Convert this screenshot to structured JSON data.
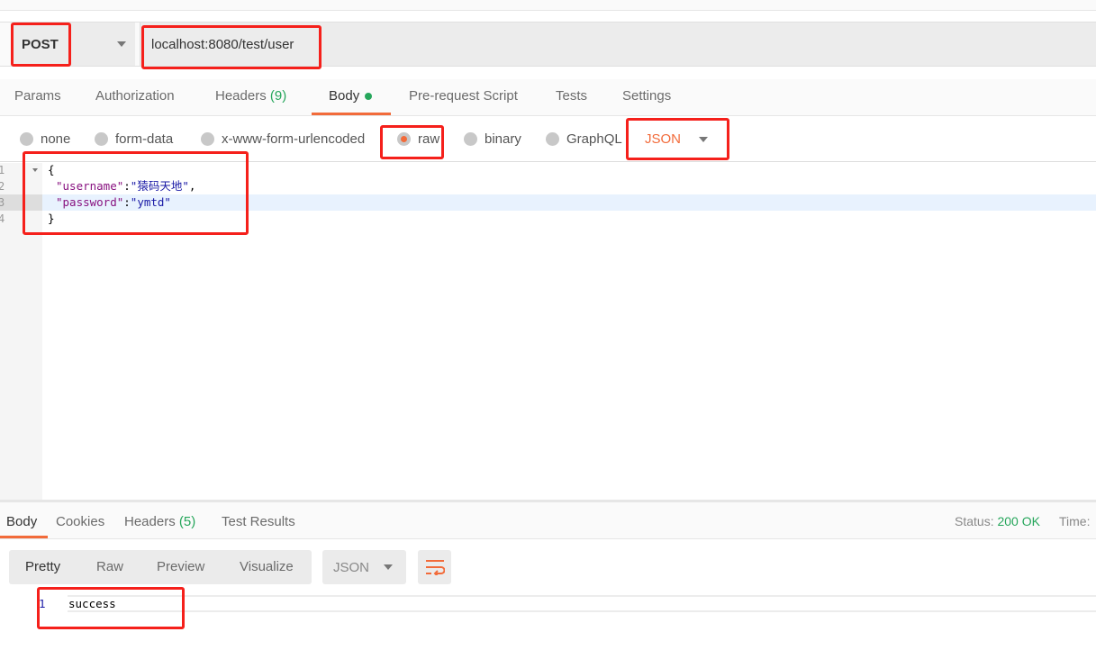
{
  "request": {
    "method": "POST",
    "url": "localhost:8080/test/user"
  },
  "request_tabs": [
    {
      "label": "Params"
    },
    {
      "label": "Authorization"
    },
    {
      "label": "Headers",
      "count": "(9)"
    },
    {
      "label": "Body",
      "active": true
    },
    {
      "label": "Pre-request Script"
    },
    {
      "label": "Tests"
    },
    {
      "label": "Settings"
    }
  ],
  "body_types": [
    {
      "label": "none"
    },
    {
      "label": "form-data"
    },
    {
      "label": "x-www-form-urlencoded"
    },
    {
      "label": "raw",
      "selected": true
    },
    {
      "label": "binary"
    },
    {
      "label": "GraphQL"
    }
  ],
  "body_format": "JSON",
  "editor": {
    "line_numbers": [
      "1",
      "2",
      "3",
      "4"
    ],
    "lines": [
      {
        "open": "{"
      },
      {
        "key": "\"username\"",
        "sep": ":",
        "value": "\"猿码天地\"",
        "end": ","
      },
      {
        "key": "\"password\"",
        "sep": ":",
        "value": "\"ymtd\"",
        "end": ""
      },
      {
        "close": "}"
      }
    ]
  },
  "response_tabs": [
    {
      "label": "Body",
      "active": true
    },
    {
      "label": "Cookies"
    },
    {
      "label": "Headers",
      "count": "(5)"
    },
    {
      "label": "Test Results"
    }
  ],
  "status": {
    "label": "Status:",
    "value": "200 OK",
    "time_label": "Time:"
  },
  "view_modes": [
    "Pretty",
    "Raw",
    "Preview",
    "Visualize"
  ],
  "response_format": "JSON",
  "response": {
    "line_number": "1",
    "text": "success"
  },
  "colors": {
    "accent": "#f26b3a",
    "success": "#26a65b",
    "annotation": "#f5201b"
  }
}
